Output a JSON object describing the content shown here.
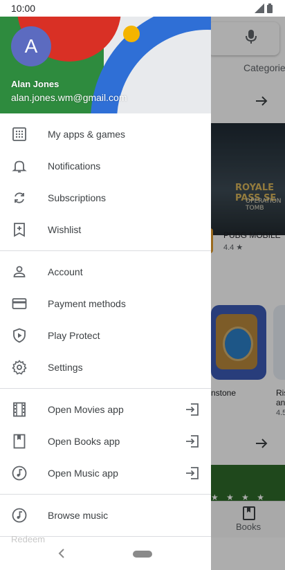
{
  "status_bar": {
    "time": "10:00"
  },
  "background_app": {
    "categories_label": "Categories",
    "banner_title": "ROYALE PASS SE",
    "banner_subtitle": "OPERATION TOMB",
    "game1": {
      "name": "PUBG MOBILE",
      "rating": "4.4 ★"
    },
    "game2_name_fragment": "nstone",
    "game3_name_fragment_1": "Ris",
    "game3_name_fragment_2": "an",
    "game3_rating_fragment": "4.5",
    "stars": "★ ★ ★ ★",
    "bottom_nav_books": "Books"
  },
  "drawer": {
    "avatar_letter": "A",
    "user_name": "Alan Jones",
    "user_email": "alan.jones.wm@gmail.com",
    "section1": [
      {
        "label": "My apps & games",
        "icon": "apps-grid-icon"
      },
      {
        "label": "Notifications",
        "icon": "bell-icon"
      },
      {
        "label": "Subscriptions",
        "icon": "refresh-icon"
      },
      {
        "label": "Wishlist",
        "icon": "bookmark-add-icon"
      }
    ],
    "section2": [
      {
        "label": "Account",
        "icon": "person-icon"
      },
      {
        "label": "Payment methods",
        "icon": "credit-card-icon"
      },
      {
        "label": "Play Protect",
        "icon": "shield-play-icon"
      },
      {
        "label": "Settings",
        "icon": "gear-icon"
      }
    ],
    "section3": [
      {
        "label": "Open Movies app",
        "icon": "film-icon"
      },
      {
        "label": "Open Books app",
        "icon": "book-icon"
      },
      {
        "label": "Open Music app",
        "icon": "music-icon"
      }
    ],
    "section4": [
      {
        "label": "Browse music",
        "icon": "music-icon"
      }
    ],
    "redeem_label": "Redeem"
  },
  "colors": {
    "avatar": "#5c6bc0",
    "header_green": "#2e8b3e",
    "header_red": "#d93025",
    "header_blue": "#2f6fd6",
    "header_yellow": "#f4b400"
  }
}
